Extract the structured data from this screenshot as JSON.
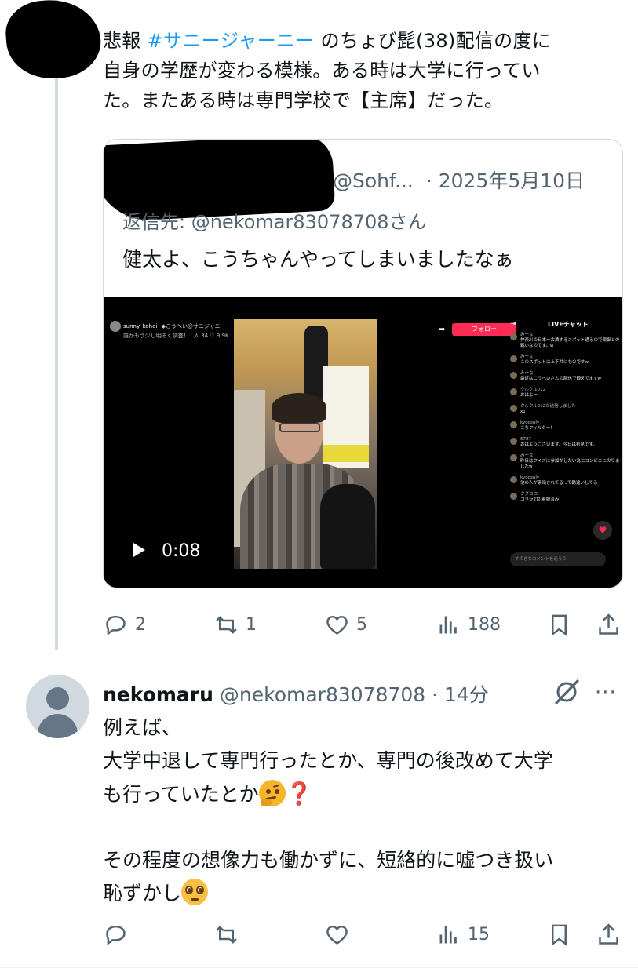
{
  "tweet1": {
    "text_pre": "悲報 ",
    "hashtag": "#サニージャーニー",
    "text_line1_post": " のちょび髭(38)配信の度に",
    "text_line2": "自身の学歴が変わる模様。ある時は大学に行ってい",
    "text_line3": "た。またある時は専門学校で【主席】だった。",
    "quote": {
      "handle": "@Sohf...",
      "date": "· 2025年5月10日",
      "reply_to": "返信先: @nekomar83078708さん",
      "text": "健太よ、こうちゃんやってしまいましたなぁ",
      "video": {
        "duration": "0:08",
        "streamer_name": "sunny_kohei",
        "streamer_sub": "◆こうへい@サニジャニ",
        "streamer_line2": "誰かもう少し明るく調査！",
        "streamer_stats": "人 34  ♡ 9.9K",
        "follow_label": "フォロー",
        "chat_title": "LIVEチャット",
        "chat_messages": [
          {
            "name": "みーな",
            "text": "神奈川の日本一古漬するスポット通るので親御との戦いなのです。w"
          },
          {
            "name": "みーな",
            "text": "このスポットは上下共になのですw"
          },
          {
            "name": "みーな",
            "text": "最近はこうへいさんの配信で鍛えてますw"
          },
          {
            "name": "クルクル012",
            "text": "おはよー"
          },
          {
            "name": "クルクル012が送信しました",
            "text": "x1"
          },
          {
            "name": "kyoosuly",
            "text": "こちフィルター！"
          },
          {
            "name": "6787",
            "text": "おはようございます。今日は初見です。"
          },
          {
            "name": "みーな",
            "text": "昨日はクイズに参加がしたい為にコンビニにのりましたw"
          },
          {
            "name": "kyoosuly",
            "text": "他の人が素晴されてるって勘違いしてる"
          },
          {
            "name": "タダコロ",
            "text": "コリラ2世 着服済み"
          }
        ],
        "chat_placeholder": "すてきなコメントを送ろう"
      }
    },
    "actions": {
      "replies": "2",
      "reposts": "1",
      "likes": "5",
      "views": "188"
    }
  },
  "tweet2": {
    "name": "nekomaru",
    "handle": "@nekomar83078708",
    "time": "· 14分",
    "line1": "例えば、",
    "line2": "大学中退して専門行ったとか、専門の後改めて大学",
    "line3": "も行っていたとか",
    "line4": "その程度の想像力も働かずに、短絡的に嘘つき扱い",
    "line5": "恥ずかし",
    "question_mark": "❓",
    "more_label": "···",
    "actions": {
      "views": "15"
    }
  },
  "colors": {
    "accent": "#1d9bf0",
    "muted": "#536471",
    "border": "#cfd9de"
  }
}
